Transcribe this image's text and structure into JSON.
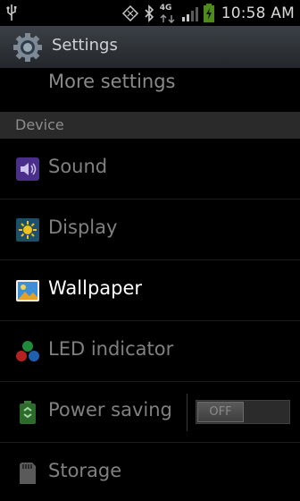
{
  "status_bar": {
    "network": "4G",
    "time": "10:58 AM",
    "icons": [
      "usb-icon",
      "rotate-icon",
      "bluetooth-icon",
      "signal-icon",
      "battery-icon"
    ]
  },
  "app": {
    "title": "Settings"
  },
  "more_settings": {
    "label": "More settings"
  },
  "section": {
    "label": "Device"
  },
  "items": [
    {
      "label": "Sound",
      "icon": "sound-icon"
    },
    {
      "label": "Display",
      "icon": "display-icon"
    },
    {
      "label": "Wallpaper",
      "icon": "wallpaper-icon"
    },
    {
      "label": "LED indicator",
      "icon": "led-indicator-icon"
    },
    {
      "label": "Power saving",
      "icon": "power-saving-icon",
      "toggle": "OFF"
    },
    {
      "label": "Storage",
      "icon": "storage-icon"
    }
  ]
}
